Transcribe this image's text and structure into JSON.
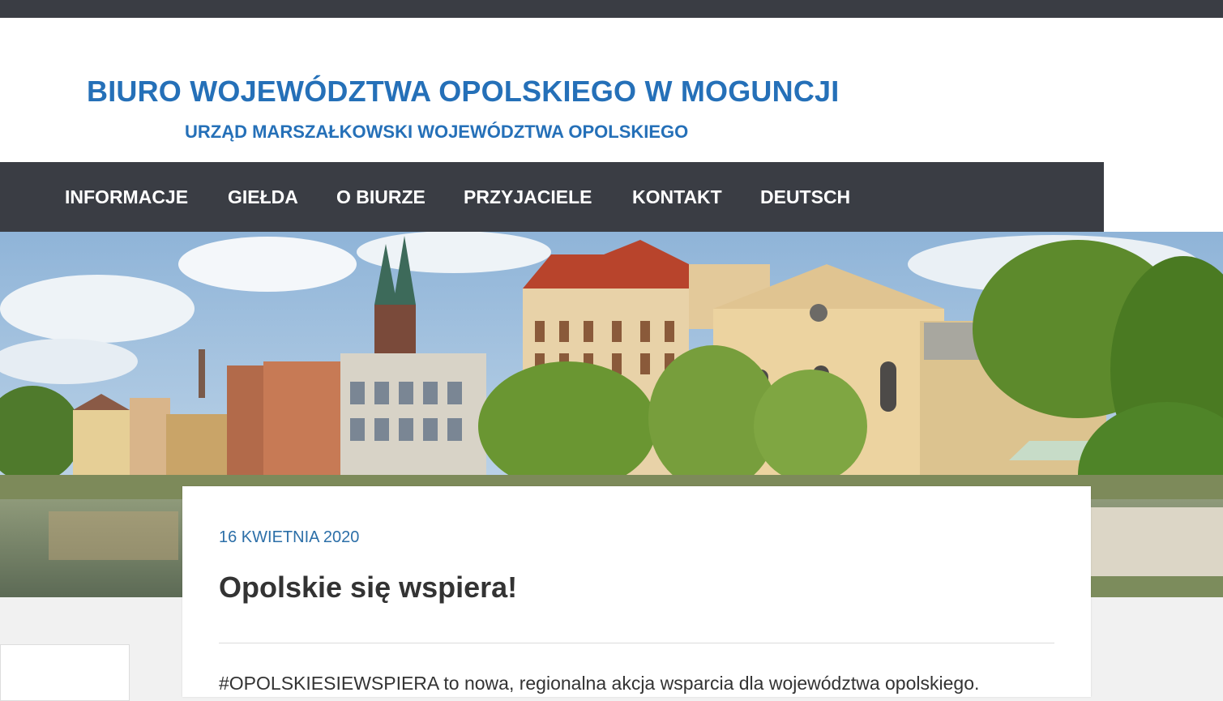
{
  "site": {
    "title": "BIURO WOJEWÓDZTWA OPOLSKIEGO W MOGUNCJI",
    "subtitle": "URZĄD MARSZAŁKOWSKI WOJEWÓDZTWA OPOLSKIEGO"
  },
  "nav": {
    "items": [
      "INFORMACJE",
      "GIEŁDA",
      "O BIURZE",
      "PRZYJACIELE",
      "KONTAKT",
      "DEUTSCH"
    ]
  },
  "colors": {
    "brand": "#2570b8",
    "nav_bg": "#3a3d44",
    "date": "#2c6fa8",
    "text": "#333333"
  },
  "post": {
    "date": "16 KWIETNIA 2020",
    "title": "Opolskie się wspiera!",
    "excerpt": "#OPOLSKIESIEWSPIERA to nowa, regionalna akcja wsparcia dla województwa opolskiego."
  }
}
